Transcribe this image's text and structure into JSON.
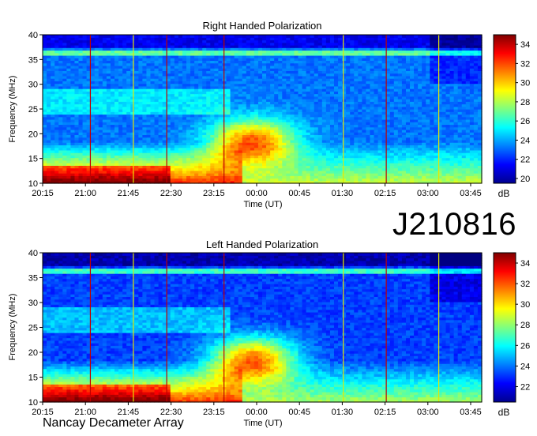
{
  "observation_id": "J210816",
  "footer_label": "Nancay Decameter Array",
  "colors": {
    "event_line_red": "#c00000",
    "event_line_yellow": "#e6e600",
    "background": "#ffffff"
  },
  "chart_data": [
    {
      "type": "heatmap",
      "title": "Right Handed Polarization",
      "xlabel": "Time (UT)",
      "ylabel": "Frequency (MHz)",
      "colorbar_label": "dB",
      "x_ticks": [
        "20:15",
        "21:00",
        "21:45",
        "22:30",
        "23:15",
        "00:00",
        "00:45",
        "01:30",
        "02:15",
        "03:00",
        "03:45"
      ],
      "y_ticks": [
        10,
        15,
        20,
        25,
        30,
        35,
        40
      ],
      "ylim": [
        10,
        40
      ],
      "colorbar_ticks": [
        20,
        22,
        24,
        26,
        28,
        30,
        32,
        34
      ],
      "clim": [
        19.5,
        35
      ],
      "colormap": "jet",
      "event_lines": [
        {
          "time": "21:05",
          "color": "red"
        },
        {
          "time": "21:50",
          "color": "yellow"
        },
        {
          "time": "22:25",
          "color": "red"
        },
        {
          "time": "23:25",
          "color": "red"
        },
        {
          "time": "01:30",
          "color": "yellow"
        },
        {
          "time": "02:15",
          "color": "red"
        },
        {
          "time": "03:10",
          "color": "yellow"
        }
      ]
    },
    {
      "type": "heatmap",
      "title": "Left Handed Polarization",
      "xlabel": "Time (UT)",
      "ylabel": "Frequency (MHz)",
      "colorbar_label": "dB",
      "x_ticks": [
        "20:15",
        "21:00",
        "21:45",
        "22:30",
        "23:15",
        "00:00",
        "00:45",
        "01:30",
        "02:15",
        "03:00",
        "03:45"
      ],
      "y_ticks": [
        10,
        15,
        20,
        25,
        30,
        35,
        40
      ],
      "ylim": [
        10,
        40
      ],
      "colorbar_ticks": [
        22,
        24,
        26,
        28,
        30,
        32,
        34
      ],
      "clim": [
        20.5,
        35
      ],
      "colormap": "jet",
      "event_lines": [
        {
          "time": "21:05",
          "color": "red"
        },
        {
          "time": "21:50",
          "color": "yellow"
        },
        {
          "time": "22:25",
          "color": "red"
        },
        {
          "time": "23:25",
          "color": "red"
        },
        {
          "time": "01:30",
          "color": "yellow"
        },
        {
          "time": "02:15",
          "color": "red"
        },
        {
          "time": "03:10",
          "color": "yellow"
        }
      ]
    }
  ]
}
